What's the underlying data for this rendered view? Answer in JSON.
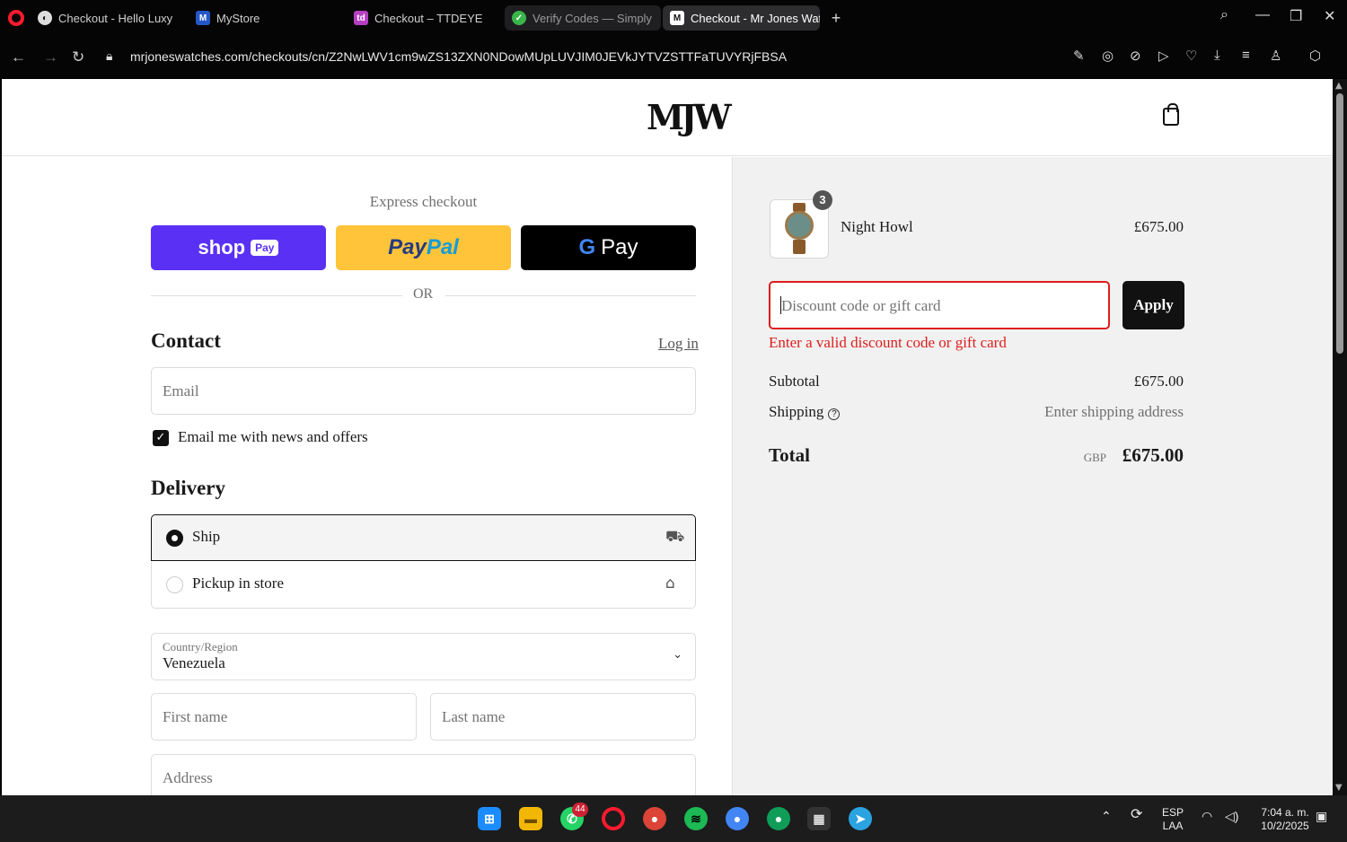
{
  "browser": {
    "tabs": [
      {
        "title": "Checkout - Hello Luxy",
        "icon": "globe-icon"
      },
      {
        "title": "MyStore",
        "icon": "store-icon"
      },
      {
        "title": "Checkout – TTDEYE",
        "icon": "td-icon"
      },
      {
        "title": "Verify Codes — Simply",
        "icon": "check-icon",
        "close": "×"
      },
      {
        "title": "Checkout - Mr Jones Watc",
        "icon": "mjw-icon",
        "active": true
      }
    ],
    "url": "mrjoneswatches.com/checkouts/cn/Z2NwLWV1cm9wZS13ZXN0NDowMUpLUVJIM0JEVkJYTVZSTTFaTUVYRjFBSA"
  },
  "store": {
    "logo": "MJW"
  },
  "checkout": {
    "express_title": "Express checkout",
    "shop_pay": {
      "shop": "shop",
      "pay": "Pay"
    },
    "paypal": {
      "pay": "Pay",
      "pal": "Pal"
    },
    "gpay": {
      "g": "G",
      "pay": "Pay"
    },
    "or": "OR",
    "contact": {
      "title": "Contact",
      "login": "Log in",
      "email_placeholder": "Email",
      "newsletter_label": "Email me with news and offers",
      "newsletter_checked": true
    },
    "delivery": {
      "title": "Delivery",
      "options": [
        {
          "label": "Ship",
          "selected": true,
          "icon": "truck-icon"
        },
        {
          "label": "Pickup in store",
          "selected": false,
          "icon": "store-icon"
        }
      ],
      "country_label": "Country/Region",
      "country_value": "Venezuela",
      "first_name_placeholder": "First name",
      "last_name_placeholder": "Last name",
      "address_placeholder": "Address"
    }
  },
  "summary": {
    "item": {
      "name": "Night Howl",
      "quantity": "3",
      "price": "£675.00"
    },
    "discount_placeholder": "Discount code or gift card",
    "apply_label": "Apply",
    "error": "Enter a valid discount code or gift card",
    "subtotal_label": "Subtotal",
    "subtotal_value": "£675.00",
    "shipping_label": "Shipping",
    "shipping_value": "Enter shipping address",
    "total_label": "Total",
    "total_currency": "GBP",
    "total_value": "£675.00"
  },
  "taskbar": {
    "whatsapp_badge": "44",
    "lang_top": "ESP",
    "lang_bottom": "LAA",
    "time": "7:04 a. m.",
    "date": "10/2/2025"
  },
  "colors": {
    "shop_pay": "#5a31f4",
    "paypal": "#ffc439",
    "error": "#dd1d1d",
    "accent_dark": "#111111"
  }
}
